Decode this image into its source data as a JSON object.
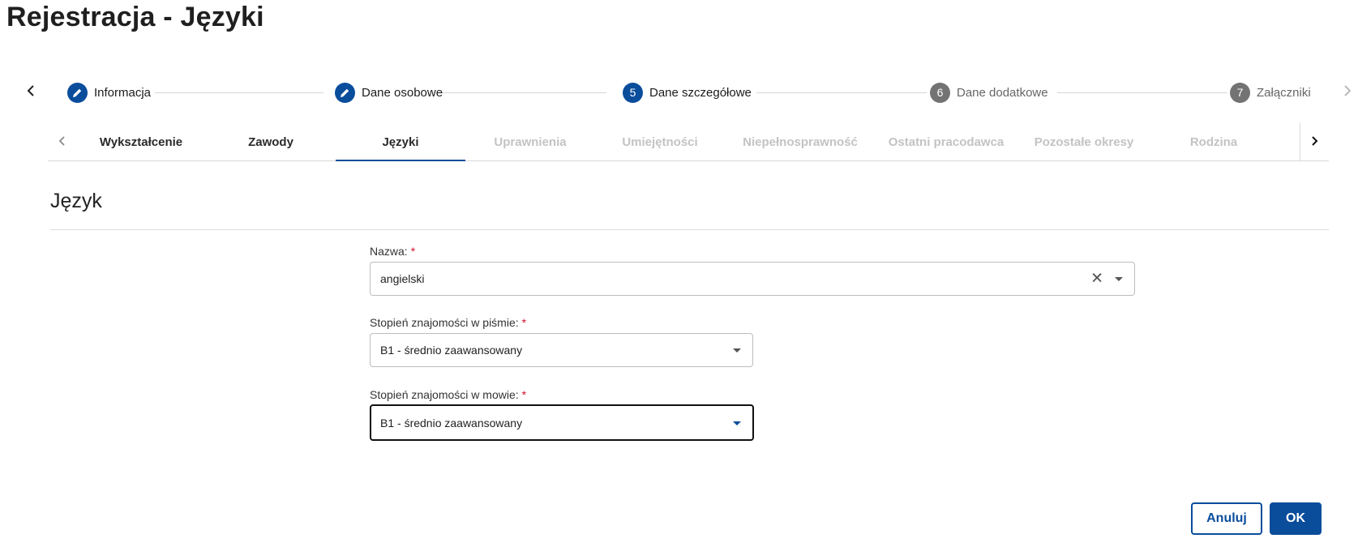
{
  "page": {
    "title": "Rejestracja - Języki"
  },
  "stepper": {
    "steps": [
      {
        "label": "Informacja",
        "state": "done",
        "number": ""
      },
      {
        "label": "Dane osobowe",
        "state": "done",
        "number": ""
      },
      {
        "label": "Dane szczegółowe",
        "state": "active",
        "number": "5"
      },
      {
        "label": "Dane dodatkowe",
        "state": "pending",
        "number": "6"
      },
      {
        "label": "Załączniki",
        "state": "pending",
        "number": "7"
      }
    ]
  },
  "tabs": {
    "items": [
      {
        "label": "Wykształcenie",
        "state": "enabled"
      },
      {
        "label": "Zawody",
        "state": "enabled"
      },
      {
        "label": "Języki",
        "state": "active"
      },
      {
        "label": "Uprawnienia",
        "state": "disabled"
      },
      {
        "label": "Umiejętności",
        "state": "disabled"
      },
      {
        "label": "Niepełnosprawność",
        "state": "disabled"
      },
      {
        "label": "Ostatni pracodawca",
        "state": "disabled"
      },
      {
        "label": "Pozostałe okresy",
        "state": "disabled"
      },
      {
        "label": "Rodzina",
        "state": "disabled"
      }
    ]
  },
  "section": {
    "title": "Język"
  },
  "form": {
    "name": {
      "label": "Nazwa:",
      "required_mark": "*",
      "value": "angielski"
    },
    "writing": {
      "label": "Stopień znajomości w piśmie:",
      "required_mark": "*",
      "value": "B1 - średnio zaawansowany"
    },
    "speaking": {
      "label": "Stopień znajomości w mowie:",
      "required_mark": "*",
      "value": "B1 - średnio zaawansowany"
    }
  },
  "actions": {
    "cancel_label": "Anuluj",
    "ok_label": "OK"
  },
  "colors": {
    "accent": "#0a4d9b",
    "required": "#d0102a",
    "pending_step": "#737373",
    "disabled_tab": "#c3c3c3"
  },
  "icons": {
    "pencil": "pencil-icon",
    "chevron_left": "chevron-left-icon",
    "chevron_right": "chevron-right-icon",
    "clear": "close-icon",
    "caret": "caret-down-icon"
  }
}
